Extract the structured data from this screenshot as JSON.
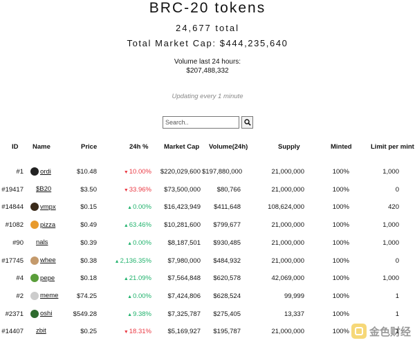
{
  "header": {
    "title": "BRC-20 tokens",
    "total": "24,677 total",
    "market_cap": "Total Market Cap: $444,235,640",
    "volume_label": "Volume last 24 hours:",
    "volume_value": "$207,488,332",
    "updating": "Updating every 1 minute"
  },
  "search": {
    "placeholder": "Search.."
  },
  "columns": [
    "ID",
    "Name",
    "Price",
    "24h %",
    "Market Cap",
    "Volume(24h)",
    "Supply",
    "Minted",
    "Limit per mint"
  ],
  "rows": [
    {
      "id": "#1",
      "name": "ordi",
      "icon": "ordi-icon",
      "icon_color": "#222222",
      "price": "$10.48",
      "change": "10.00%",
      "dir": "down",
      "mcap": "$220,029,600",
      "volume": "$197,880,000",
      "supply": "21,000,000",
      "minted": "100%",
      "limit": "1,000"
    },
    {
      "id": "#19417",
      "name": "$B20",
      "icon": "",
      "icon_color": "",
      "price": "$3.50",
      "change": "33.96%",
      "dir": "down",
      "mcap": "$73,500,000",
      "volume": "$80,766",
      "supply": "21,000,000",
      "minted": "100%",
      "limit": "0"
    },
    {
      "id": "#14844",
      "name": "vmpx",
      "icon": "vmpx-icon",
      "icon_color": "#3a2a1a",
      "price": "$0.15",
      "change": "0.00%",
      "dir": "up",
      "mcap": "$16,423,949",
      "volume": "$411,648",
      "supply": "108,624,000",
      "minted": "100%",
      "limit": "420"
    },
    {
      "id": "#1082",
      "name": "pizza",
      "icon": "pizza-icon",
      "icon_color": "#e89a2c",
      "price": "$0.49",
      "change": "63.46%",
      "dir": "up",
      "mcap": "$10,281,600",
      "volume": "$799,677",
      "supply": "21,000,000",
      "minted": "100%",
      "limit": "1,000"
    },
    {
      "id": "#90",
      "name": "nals",
      "icon": "",
      "icon_color": "",
      "price": "$0.39",
      "change": "0.00%",
      "dir": "up",
      "mcap": "$8,187,501",
      "volume": "$930,485",
      "supply": "21,000,000",
      "minted": "100%",
      "limit": "1,000"
    },
    {
      "id": "#17745",
      "name": "whee",
      "icon": "whee-icon",
      "icon_color": "#c49a6c",
      "price": "$0.38",
      "change": "2,136.35%",
      "dir": "up",
      "mcap": "$7,980,000",
      "volume": "$484,932",
      "supply": "21,000,000",
      "minted": "100%",
      "limit": "0"
    },
    {
      "id": "#4",
      "name": "pepe",
      "icon": "pepe-icon",
      "icon_color": "#5a9e3a",
      "price": "$0.18",
      "change": "21.09%",
      "dir": "up",
      "mcap": "$7,564,848",
      "volume": "$620,578",
      "supply": "42,069,000",
      "minted": "100%",
      "limit": "1,000"
    },
    {
      "id": "#2",
      "name": "meme",
      "icon": "meme-icon",
      "icon_color": "#cccccc",
      "price": "$74.25",
      "change": "0.00%",
      "dir": "up",
      "mcap": "$7,424,806",
      "volume": "$628,524",
      "supply": "99,999",
      "minted": "100%",
      "limit": "1"
    },
    {
      "id": "#2371",
      "name": "oshi",
      "icon": "oshi-icon",
      "icon_color": "#2e6b2e",
      "price": "$549.28",
      "change": "9.38%",
      "dir": "up",
      "mcap": "$7,325,787",
      "volume": "$275,405",
      "supply": "13,337",
      "minted": "100%",
      "limit": "1"
    },
    {
      "id": "#14407",
      "name": "zbit",
      "icon": "",
      "icon_color": "",
      "price": "$0.25",
      "change": "18.31%",
      "dir": "down",
      "mcap": "$5,169,927",
      "volume": "$195,787",
      "supply": "21,000,000",
      "minted": "100%",
      "limit": "1"
    }
  ],
  "watermark": {
    "text": "金色财经"
  },
  "colors": {
    "up": "#20b26c",
    "down": "#ea3943"
  }
}
